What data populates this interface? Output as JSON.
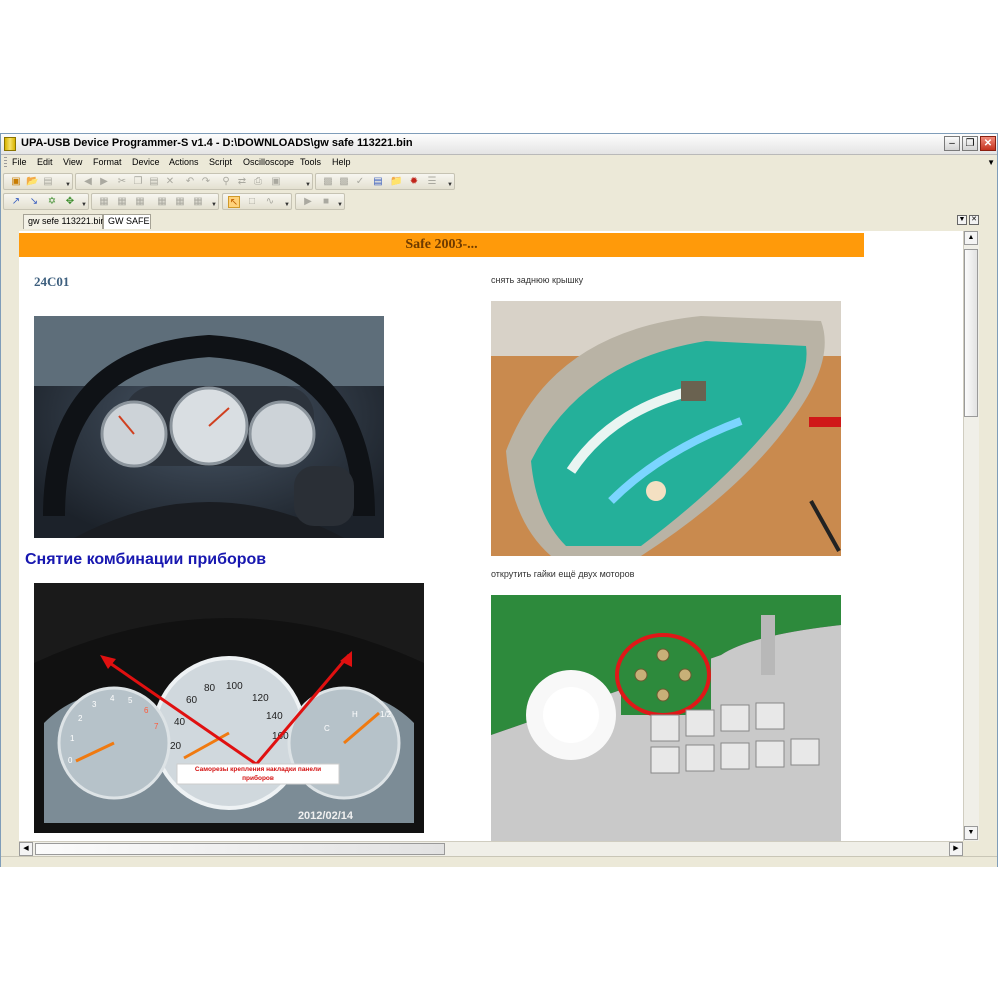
{
  "window": {
    "title": "UPA-USB Device Programmer-S v1.4 - D:\\DOWNLOADS\\gw safe 113221.bin"
  },
  "menu": [
    "File",
    "Edit",
    "View",
    "Format",
    "Device",
    "Actions",
    "Script",
    "Oscilloscope",
    "Tools",
    "Help"
  ],
  "tabs": [
    {
      "label": "gw sefe 113221.bin",
      "active": false
    },
    {
      "label": "GW SAFE",
      "active": true
    }
  ],
  "page": {
    "banner": "Safe 2003-...",
    "chip": "24C01",
    "section_heading": "Снятие комбинации приборов",
    "caption_1": "снять заднюю крышку",
    "caption_2": "открутить гайки ещё двух моторов",
    "photo_3_callout": "Саморезы крепления накладки панели приборов",
    "photo_3_date": "2012/02/14",
    "speedo_ticks": [
      "20",
      "40",
      "60",
      "80",
      "100",
      "120",
      "140",
      "160"
    ],
    "tacho_ticks": [
      "0",
      "1",
      "2",
      "3",
      "4",
      "5",
      "6",
      "7"
    ],
    "temp_ticks": [
      "C",
      "H"
    ],
    "fuel_ticks": [
      "1/2"
    ]
  },
  "colors": {
    "banner_bg": "#ff9a0a",
    "banner_text": "#6d3a00",
    "chip_text": "#3d5f7e",
    "heading_text": "#1717b0",
    "window_chrome": "#ece9d8"
  },
  "icons": {
    "app": "chip-icon",
    "minimize": "minimize-icon",
    "restore": "restore-icon",
    "close": "close-icon"
  }
}
